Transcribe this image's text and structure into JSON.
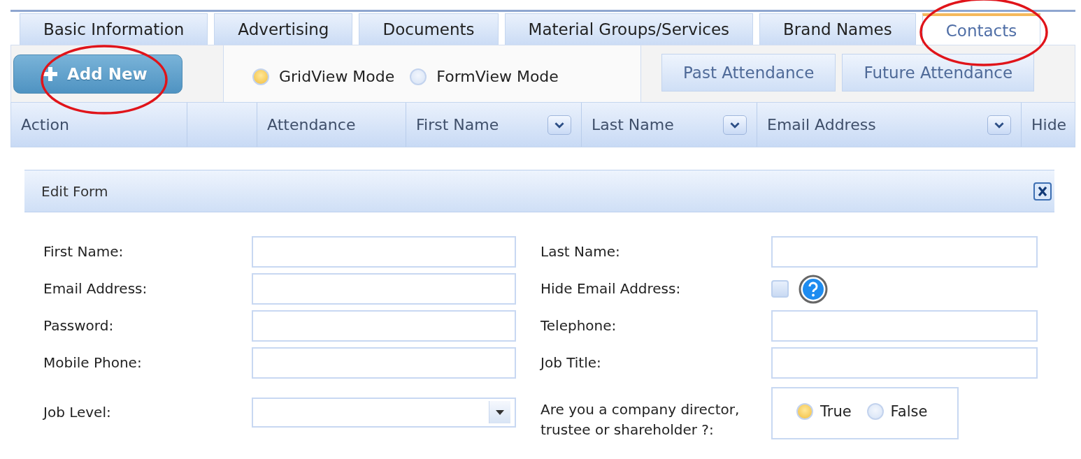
{
  "tabs": [
    {
      "label": "Basic Information",
      "selected": false,
      "circled": false
    },
    {
      "label": "Advertising",
      "selected": false,
      "circled": false
    },
    {
      "label": "Documents",
      "selected": false,
      "circled": false
    },
    {
      "label": "Material Groups/Services",
      "selected": false,
      "circled": false
    },
    {
      "label": "Brand Names",
      "selected": false,
      "circled": false
    },
    {
      "label": "Contacts",
      "selected": true,
      "circled": true
    }
  ],
  "toolbar": {
    "add_button": {
      "label": "Add New",
      "circled": true
    },
    "view_modes": [
      {
        "label": "GridView Mode",
        "selected": true
      },
      {
        "label": "FormView Mode",
        "selected": false
      }
    ],
    "buttons": [
      "Past Attendance",
      "Future Attendance"
    ]
  },
  "grid": {
    "columns": [
      {
        "label": "Action",
        "filter": false
      },
      {
        "filter": false
      },
      {
        "label": "Attendance",
        "filter": false
      },
      {
        "label": "First Name",
        "filter": true
      },
      {
        "label": "Last Name",
        "filter": true
      },
      {
        "label": "Email Address",
        "filter": true
      },
      {
        "label": "Hide",
        "filter": false
      }
    ]
  },
  "edit_form": {
    "title": "Edit Form",
    "fields": [
      {
        "label": "First Name:",
        "kind": "text"
      },
      {
        "label": "Last Name:",
        "kind": "text"
      },
      {
        "label": "Email Address:",
        "kind": "text"
      },
      {
        "label": "Hide Email Address:",
        "kind": "checkbox",
        "checked": false
      },
      {
        "label": "Password:",
        "kind": "text"
      },
      {
        "label": "Telephone:",
        "kind": "text"
      },
      {
        "label": "Mobile Phone:",
        "kind": "text"
      },
      {
        "label": "Job Title:",
        "kind": "text"
      },
      {
        "label": "Job Level:",
        "kind": "select"
      },
      {
        "label": "Are you a company director, trustee or shareholder ?:",
        "kind": "radio",
        "options": [
          {
            "label": "True",
            "selected": true
          },
          {
            "label": "False",
            "selected": false
          }
        ]
      }
    ]
  }
}
